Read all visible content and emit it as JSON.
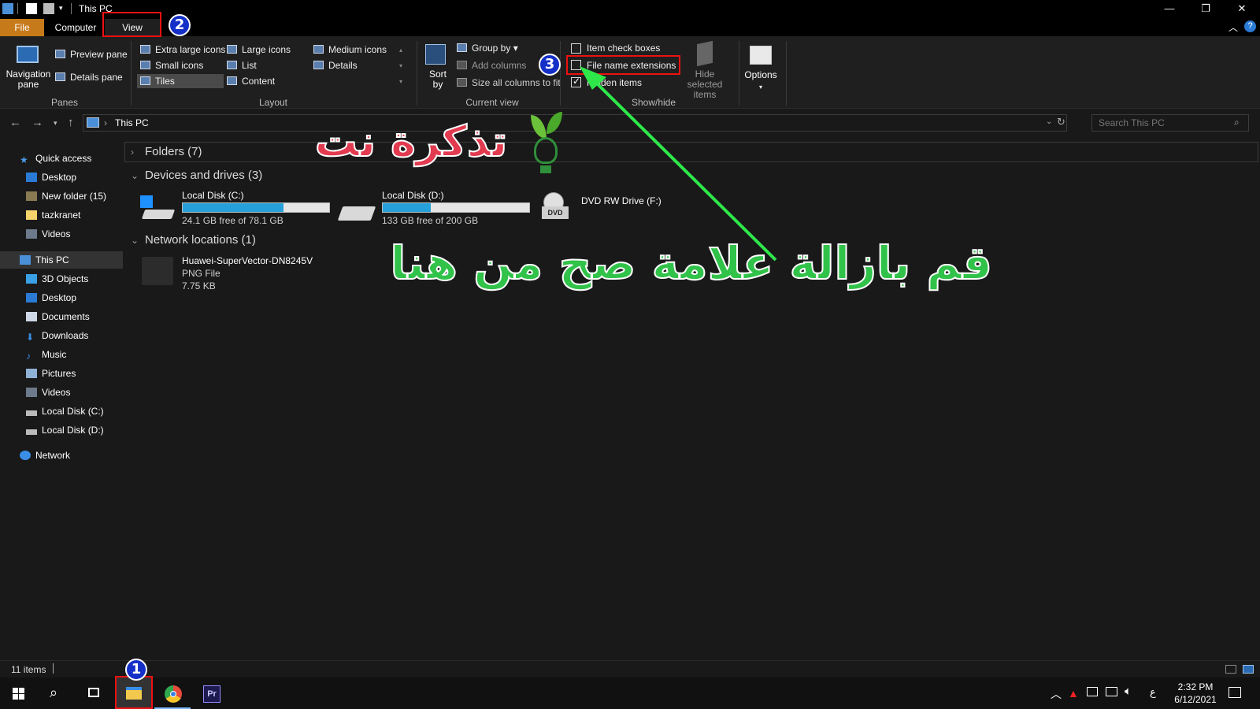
{
  "window": {
    "title": "This PC",
    "minimize_glyph": "—",
    "restore_glyph": "❐",
    "close_glyph": "✕"
  },
  "tabs": {
    "file": "File",
    "computer": "Computer",
    "view": "View"
  },
  "ribbon": {
    "panes": {
      "label": "Panes",
      "navigation_pane": "Navigation pane",
      "preview_pane": "Preview pane",
      "details_pane": "Details pane"
    },
    "layout": {
      "label": "Layout",
      "items": [
        "Extra large icons",
        "Large icons",
        "Medium icons",
        "Small icons",
        "List",
        "Details",
        "Tiles",
        "Content"
      ]
    },
    "current_view": {
      "label": "Current view",
      "sort_by": "Sort by",
      "group_by": "Group by",
      "add_columns": "Add columns",
      "size_all_columns": "Size all columns to fit"
    },
    "show_hide": {
      "label": "Show/hide",
      "item_check_boxes": "Item check boxes",
      "file_name_extensions": "File name extensions",
      "hidden_items": "Hidden items",
      "hide_selected_items": "Hide selected items",
      "item_check_boxes_checked": false,
      "file_name_extensions_checked": false,
      "hidden_items_checked": true
    },
    "options": "Options"
  },
  "address": {
    "path": "This PC",
    "search_placeholder": "Search This PC"
  },
  "sidebar": {
    "quick_access": "Quick access",
    "quick_items": [
      "Desktop",
      "New folder (15)",
      "tazkranet",
      "Videos"
    ],
    "this_pc": "This PC",
    "pc_items": [
      "3D Objects",
      "Desktop",
      "Documents",
      "Downloads",
      "Music",
      "Pictures",
      "Videos",
      "Local Disk (C:)",
      "Local Disk (D:)"
    ],
    "network": "Network"
  },
  "main": {
    "folders_header": "Folders (7)",
    "devices_header": "Devices and drives (3)",
    "network_header": "Network locations (1)",
    "drives": [
      {
        "name": "Local Disk (C:)",
        "free": "24.1 GB free of 78.1 GB",
        "used_fraction": 0.69
      },
      {
        "name": "Local Disk (D:)",
        "free": "133 GB free of 200 GB",
        "used_fraction": 0.33
      },
      {
        "name": "DVD RW Drive (F:)",
        "free": "",
        "dvd_label": "DVD"
      }
    ],
    "network_item": {
      "name": "Huawei-SuperVector-DN8245V",
      "type": "PNG File",
      "size": "7.75 KB"
    }
  },
  "status": {
    "items": "11 items"
  },
  "taskbar": {
    "premiere": "Pr",
    "time": "2:32 PM",
    "date": "6/12/2021",
    "lang": "ع"
  },
  "annotations": {
    "badges": [
      "1",
      "2",
      "3"
    ],
    "caption": "قم بازالة علامة صح من هنا",
    "logo": "تذكرة نت"
  },
  "colors": {
    "accent_file_tab": "#c77a1a",
    "drive_bar": "#26a0da",
    "annotation_red": "#e11111",
    "arrow_green": "#2ee84a",
    "badge_blue": "#1530c8"
  }
}
